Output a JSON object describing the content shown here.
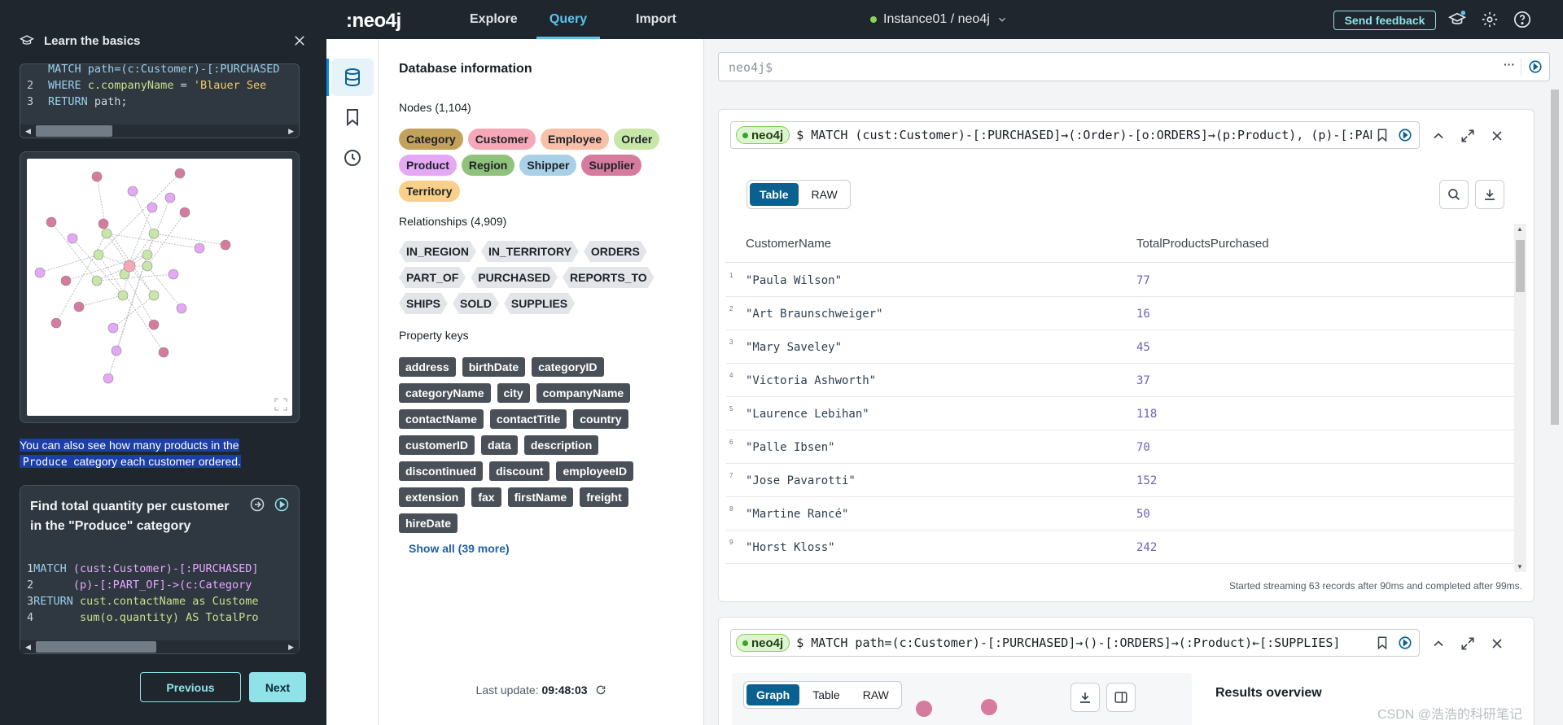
{
  "guide": {
    "title": "Learn the basics",
    "code1": {
      "lines": [
        {
          "n": "",
          "parts": [
            {
              "t": "MATCH path=(c:Customer)-[:PURCHASED",
              "c": "kw"
            }
          ]
        },
        {
          "n": "2",
          "parts": [
            {
              "t": "WHERE ",
              "c": "kw"
            },
            {
              "t": "c.companyName",
              "c": "prop"
            },
            {
              "t": " = ",
              "c": ""
            },
            {
              "t": "'Blauer See",
              "c": "str"
            }
          ]
        },
        {
          "n": "3",
          "parts": [
            {
              "t": "RETURN ",
              "c": "kw"
            },
            {
              "t": "path;",
              "c": ""
            }
          ]
        }
      ]
    },
    "explain": {
      "line1": "You can also see how many products in the",
      "code": "Produce",
      "line2": "category each customer ordered."
    },
    "card2": {
      "title": "Find total quantity per customer in the \"Produce\" category",
      "lines": [
        {
          "n": "1",
          "parts": [
            {
              "t": "MATCH ",
              "c": "kw"
            },
            {
              "t": "(cust:Customer)-[:PURCHASED]",
              "c": "lbl"
            }
          ]
        },
        {
          "n": "2",
          "parts": [
            {
              "t": "      (p)-[:PART_OF]->(c:Category",
              "c": "lbl"
            }
          ]
        },
        {
          "n": "3",
          "parts": [
            {
              "t": "RETURN ",
              "c": "kw"
            },
            {
              "t": "cust.contactName as Custome",
              "c": "prop"
            }
          ]
        },
        {
          "n": "4",
          "parts": [
            {
              "t": "       sum(o.quantity) AS TotalPro",
              "c": "prop"
            }
          ]
        }
      ]
    },
    "prev_label": "Previous",
    "next_label": "Next"
  },
  "topbar": {
    "logo": ":neo4j",
    "tabs": [
      {
        "label": "Explore",
        "active": false
      },
      {
        "label": "Query",
        "active": true
      },
      {
        "label": "Import",
        "active": false
      }
    ],
    "instance": "Instance01 / neo4j",
    "feedback_label": "Send feedback"
  },
  "dbinfo": {
    "title": "Database information",
    "nodes_label": "Nodes (1,104)",
    "nodes": [
      {
        "name": "Category",
        "color": "#c4a15a"
      },
      {
        "name": "Customer",
        "color": "#f7a8b8"
      },
      {
        "name": "Employee",
        "color": "#f9c0a8"
      },
      {
        "name": "Order",
        "color": "#c8e6a8"
      },
      {
        "name": "Product",
        "color": "#e4a8f5"
      },
      {
        "name": "Region",
        "color": "#8fc27a"
      },
      {
        "name": "Shipper",
        "color": "#a8d0e6"
      },
      {
        "name": "Supplier",
        "color": "#d67a9e"
      },
      {
        "name": "Territory",
        "color": "#f9d08a"
      }
    ],
    "rels_label": "Relationships (4,909)",
    "relationships": [
      "IN_REGION",
      "IN_TERRITORY",
      "ORDERS",
      "PART_OF",
      "PURCHASED",
      "REPORTS_TO",
      "SHIPS",
      "SOLD",
      "SUPPLIES"
    ],
    "props_label": "Property keys",
    "properties": [
      "address",
      "birthDate",
      "categoryID",
      "categoryName",
      "city",
      "companyName",
      "contactName",
      "contactTitle",
      "country",
      "customerID",
      "data",
      "description",
      "discontinued",
      "discount",
      "employeeID",
      "extension",
      "fax",
      "firstName",
      "freight",
      "hireDate"
    ],
    "show_all": "Show all (39 more)",
    "last_update_label": "Last update: ",
    "last_update_time": "09:48:03"
  },
  "editor": {
    "placeholder": "neo4j$"
  },
  "frame1": {
    "db": "neo4j",
    "query": "$ MATCH (cust:Customer)-[:PURCHASED]→(:Order)-[o:ORDERS]→(p:Product), (p)-[:PART_OF]",
    "view_tabs": [
      {
        "label": "Table",
        "active": true
      },
      {
        "label": "RAW",
        "active": false
      }
    ],
    "columns": [
      "CustomerName",
      "TotalProductsPurchased"
    ],
    "rows": [
      {
        "n": "1",
        "name": "\"Paula Wilson\"",
        "total": "77"
      },
      {
        "n": "2",
        "name": "\"Art Braunschweiger\"",
        "total": "16"
      },
      {
        "n": "3",
        "name": "\"Mary Saveley\"",
        "total": "45"
      },
      {
        "n": "4",
        "name": "\"Victoria Ashworth\"",
        "total": "37"
      },
      {
        "n": "5",
        "name": "\"Laurence Lebihan\"",
        "total": "118"
      },
      {
        "n": "6",
        "name": "\"Palle Ibsen\"",
        "total": "70"
      },
      {
        "n": "7",
        "name": "\"Jose Pavarotti\"",
        "total": "152"
      },
      {
        "n": "8",
        "name": "\"Martine Rancé\"",
        "total": "50"
      },
      {
        "n": "9",
        "name": "\"Horst Kloss\"",
        "total": "242"
      }
    ],
    "status": "Started streaming 63 records after 90ms and completed after 99ms."
  },
  "frame2": {
    "db": "neo4j",
    "query": "$ MATCH path=(c:Customer)-[:PURCHASED]→()-[:ORDERS]→(:Product)←[:SUPPLIES]",
    "view_tabs": [
      {
        "label": "Graph",
        "active": true
      },
      {
        "label": "Table",
        "active": false
      },
      {
        "label": "RAW",
        "active": false
      }
    ],
    "results_overview": "Results overview"
  },
  "watermark": "CSDN @浩浩的科研笔记",
  "colors": {
    "accent": "#5bc4ec",
    "guide_bg": "#1f262e",
    "feedback": "#8fe3e8",
    "active_seg": "#0a6190"
  }
}
